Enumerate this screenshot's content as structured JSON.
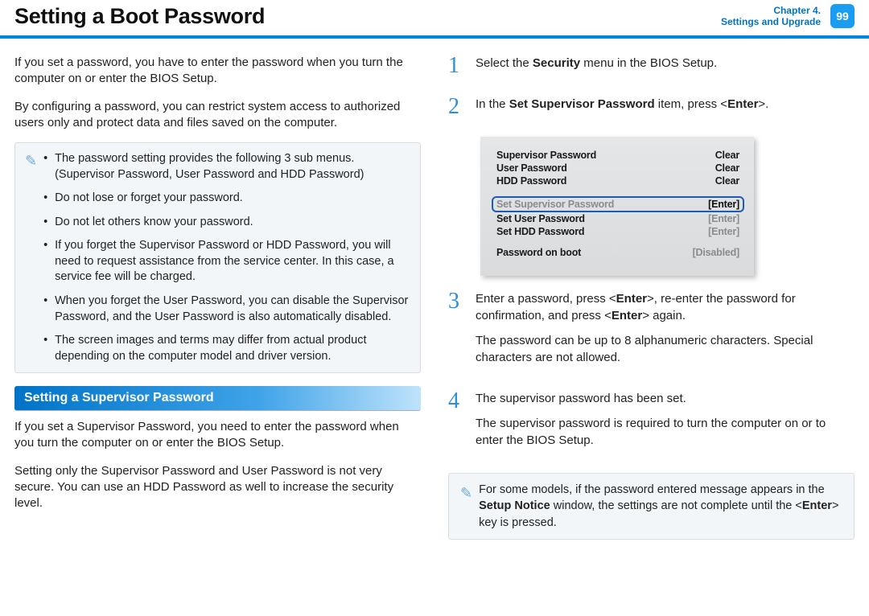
{
  "header": {
    "title": "Setting a Boot Password",
    "chapter_line1": "Chapter 4.",
    "chapter_line2": "Settings and Upgrade",
    "page_number": "99"
  },
  "left": {
    "p1": "If you set a password, you have to enter the password when you turn the computer on or enter the BIOS Setup.",
    "p2": "By configuring a password, you can restrict system access to authorized users only and protect data and files saved on the computer.",
    "notes": [
      "The password setting provides the following 3 sub menus. (Supervisor Password, User Password and HDD Password)",
      "Do not lose or forget your password.",
      "Do not let others know your password.",
      "If you forget the Supervisor Password or HDD Password, you will need to request assistance from the service center. In this case, a service fee will be charged.",
      "When you forget the User Password, you can disable the Supervisor Password, and the User Password is also automatically disabled.",
      "The screen images and terms may differ from actual product depending on the computer model and driver version."
    ],
    "section_header": "Setting a Supervisor Password",
    "p3": "If you set a Supervisor Password, you need to enter the password when you turn the computer on or enter the BIOS Setup.",
    "p4": "Setting only the Supervisor Password and User Password is not very secure. You can use an HDD Password as well to increase the security level."
  },
  "steps": {
    "s1_pre": "Select the ",
    "s1_bold": "Security",
    "s1_post": " menu in the BIOS Setup.",
    "s2_pre": "In the ",
    "s2_bold": "Set Supervisor Password",
    "s2_mid": " item, press <",
    "s2_enter": "Enter",
    "s2_post": ">.",
    "s3_a_pre": "Enter a password, press <",
    "s3_a_b1": "Enter",
    "s3_a_mid": ">, re-enter the password for confirmation, and press <",
    "s3_a_b2": "Enter",
    "s3_a_post": "> again.",
    "s3_b": "The password can be up to 8 alphanumeric characters. Special characters are not allowed.",
    "s4_a": "The supervisor password has been set.",
    "s4_b": "The supervisor password is required to turn the computer on or to enter the BIOS Setup.",
    "note2_pre": "For some models, if the password entered message appears in the ",
    "note2_bold": "Setup Notice",
    "note2_mid": " window, the settings are not complete until the <",
    "note2_enter": "Enter",
    "note2_post": "> key is pressed."
  },
  "bios": {
    "r1_l": "Supervisor Password",
    "r1_r": "Clear",
    "r2_l": "User Password",
    "r2_r": "Clear",
    "r3_l": "HDD Password",
    "r3_r": "Clear",
    "r4_l": "Set Supervisor Password",
    "r4_r": "[Enter]",
    "r5_l": "Set User Password",
    "r5_r": "[Enter]",
    "r6_l": "Set HDD Password",
    "r6_r": "[Enter]",
    "r7_l": "Password on boot",
    "r7_r": "[Disabled]"
  }
}
